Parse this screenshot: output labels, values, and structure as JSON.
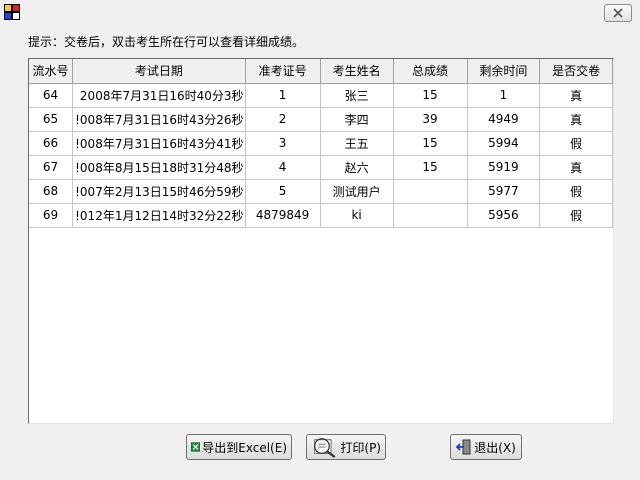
{
  "hint": "提示：交卷后，双击考生所在行可以查看详细成绩。",
  "table": {
    "columns": [
      "流水号",
      "考试日期",
      "准考证号",
      "考生姓名",
      "总成绩",
      "剩余时间",
      "是否交卷"
    ],
    "rows": [
      [
        "64",
        "2008年7月31日16时40分3秒",
        "1",
        "张三",
        "15",
        "1",
        "真"
      ],
      [
        "65",
        "!008年7月31日16时43分26秒",
        "2",
        "李四",
        "39",
        "4949",
        "真"
      ],
      [
        "66",
        "!008年7月31日16时43分41秒",
        "3",
        "王五",
        "15",
        "5994",
        "假"
      ],
      [
        "67",
        "!008年8月15日18时31分48秒",
        "4",
        "赵六",
        "15",
        "5919",
        "真"
      ],
      [
        "68",
        "!007年2月13日15时46分59秒",
        "5",
        "测试用户",
        "",
        "5977",
        "假"
      ],
      [
        "69",
        "!012年1月12日14时32分22秒",
        "4879849",
        "ki",
        "",
        "5956",
        "假"
      ]
    ]
  },
  "buttons": {
    "export": "导出到Excel(E)",
    "print": "打印(P)",
    "exit": "退出(X)"
  },
  "icons": {
    "app": "app-grid-icon",
    "close": "close-icon",
    "export": "excel-icon",
    "print": "print-preview-icon",
    "exit": "exit-door-icon"
  }
}
